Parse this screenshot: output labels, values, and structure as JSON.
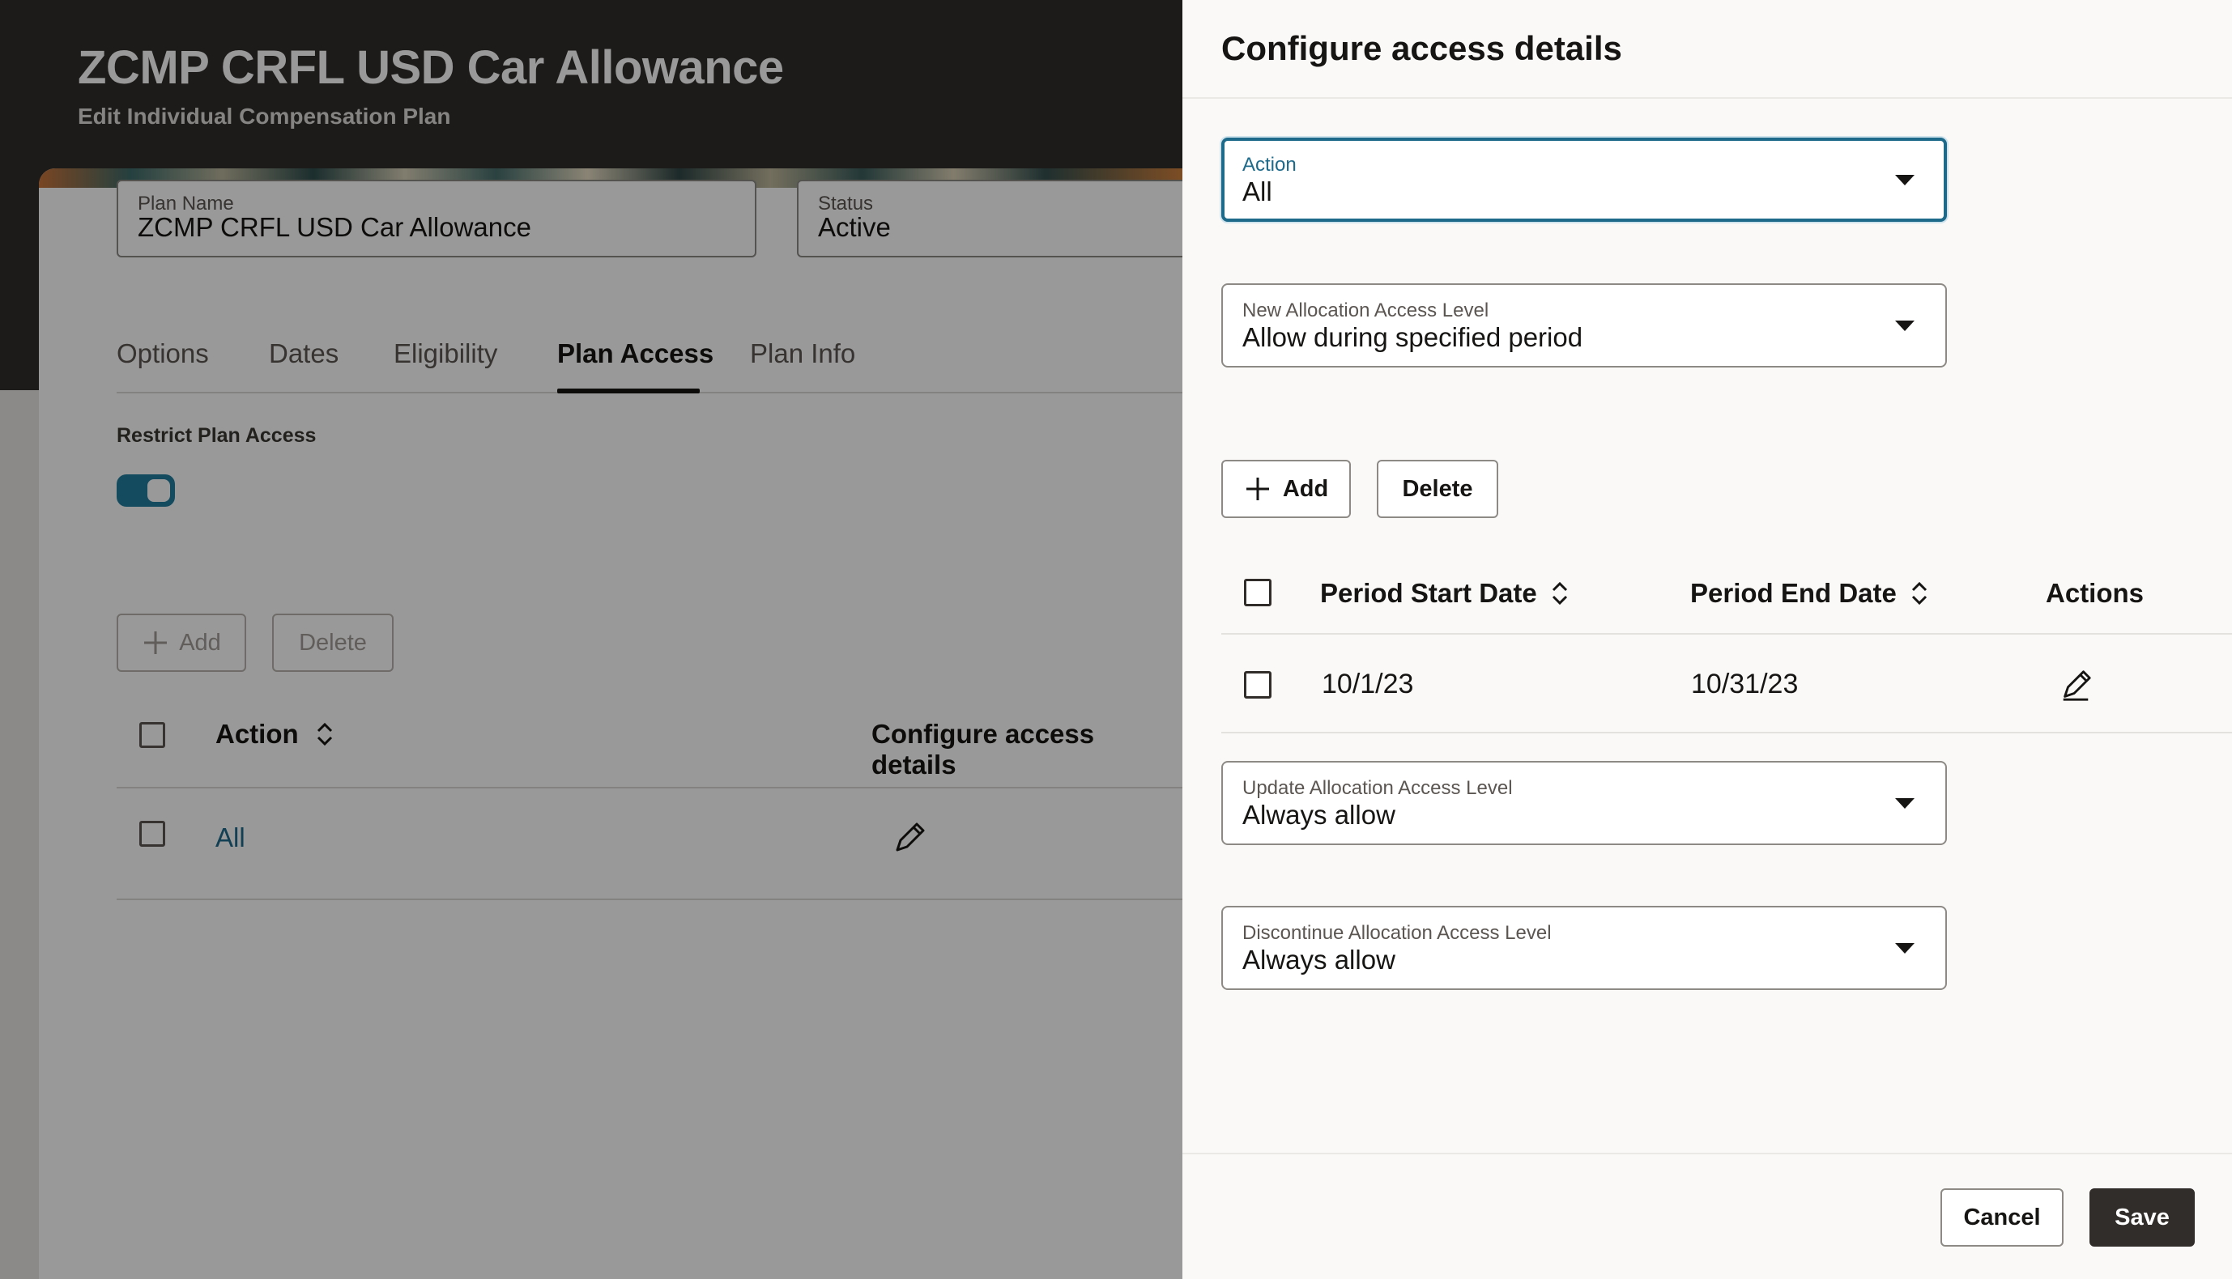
{
  "background": {
    "title": "ZCMP CRFL USD Car Allowance",
    "subtitle": "Edit Individual Compensation Plan",
    "plan_name": {
      "label": "Plan Name",
      "value": "ZCMP CRFL USD Car Allowance"
    },
    "status": {
      "label": "Status",
      "value": "Active"
    },
    "tabs": [
      {
        "label": "Options"
      },
      {
        "label": "Dates"
      },
      {
        "label": "Eligibility"
      },
      {
        "label": "Plan Access",
        "active": true
      },
      {
        "label": "Plan Info"
      }
    ],
    "restrict_label": "Restrict Plan Access",
    "restrict_toggle_on": true,
    "add_label": "Add",
    "delete_label": "Delete",
    "table": {
      "col_action": "Action",
      "col_configure": "Configure access details",
      "rows": [
        {
          "action": "All"
        }
      ]
    }
  },
  "drawer": {
    "title": "Configure access details",
    "action_select": {
      "label": "Action",
      "value": "All"
    },
    "new_allocation": {
      "label": "New Allocation Access Level",
      "value": "Allow during specified period"
    },
    "add_label": "Add",
    "delete_label": "Delete",
    "periods_table": {
      "columns": [
        "Period Start Date",
        "Period End Date",
        "Actions"
      ],
      "rows": [
        {
          "start": "10/1/23",
          "end": "10/31/23"
        }
      ]
    },
    "update_allocation": {
      "label": "Update Allocation Access Level",
      "value": "Always allow"
    },
    "discontinue_allocation": {
      "label": "Discontinue Allocation Access Level",
      "value": "Always allow"
    },
    "cancel_label": "Cancel",
    "save_label": "Save"
  },
  "colors": {
    "header_dark": "#312d2a",
    "accent_teal": "#1d6a8b",
    "toggle_on": "#227e9e",
    "primary_button": "#312d2a"
  }
}
